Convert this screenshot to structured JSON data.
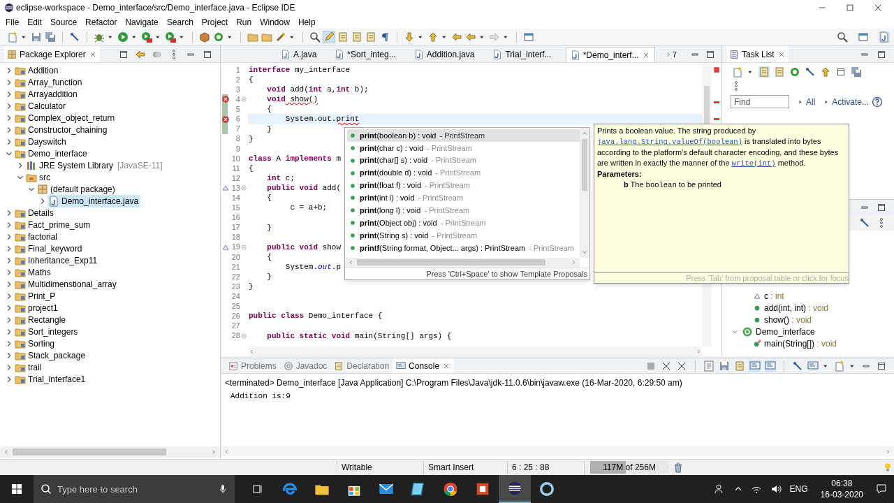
{
  "window": {
    "title": "eclipse-workspace - Demo_interface/src/Demo_interface.java - Eclipse IDE"
  },
  "menu": [
    "File",
    "Edit",
    "Source",
    "Refactor",
    "Navigate",
    "Search",
    "Project",
    "Run",
    "Window",
    "Help"
  ],
  "package_explorer": {
    "title": "Package Explorer",
    "items": [
      {
        "label": "Addition",
        "kind": "project",
        "expanded": false,
        "selected": false
      },
      {
        "label": "Array_function",
        "kind": "project",
        "expanded": false,
        "selected": false
      },
      {
        "label": "Arrayaddition",
        "kind": "project",
        "expanded": false,
        "selected": false
      },
      {
        "label": "Calculator",
        "kind": "project",
        "expanded": false,
        "selected": false
      },
      {
        "label": "Complex_object_return",
        "kind": "project",
        "expanded": false,
        "selected": false
      },
      {
        "label": "Constructor_chaining",
        "kind": "project",
        "expanded": false,
        "selected": false
      },
      {
        "label": "Dayswitch",
        "kind": "project",
        "expanded": false,
        "selected": false
      },
      {
        "label": "Demo_interface",
        "kind": "project",
        "expanded": true,
        "selected": false,
        "children": [
          {
            "label": "JRE System Library",
            "decoration": "[JavaSE-11]",
            "kind": "library",
            "expanded": false,
            "selected": false
          },
          {
            "label": "src",
            "kind": "folder",
            "expanded": true,
            "selected": false,
            "children": [
              {
                "label": "(default package)",
                "kind": "package",
                "expanded": true,
                "selected": false,
                "children": [
                  {
                    "label": "Demo_interface.java",
                    "kind": "file",
                    "expanded": false,
                    "selected": true
                  }
                ]
              }
            ]
          }
        ]
      },
      {
        "label": "Details",
        "kind": "project",
        "expanded": false,
        "selected": false
      },
      {
        "label": "Fact_prime_sum",
        "kind": "project",
        "expanded": false,
        "selected": false
      },
      {
        "label": "factorial",
        "kind": "project",
        "expanded": false,
        "selected": false
      },
      {
        "label": "Final_keyword",
        "kind": "project",
        "expanded": false,
        "selected": false
      },
      {
        "label": "Inheritance_Exp11",
        "kind": "project",
        "expanded": false,
        "selected": false
      },
      {
        "label": "Maths",
        "kind": "project",
        "expanded": false,
        "selected": false
      },
      {
        "label": "Multidimenstional_array",
        "kind": "project",
        "expanded": false,
        "selected": false
      },
      {
        "label": "Print_P",
        "kind": "project",
        "expanded": false,
        "selected": false
      },
      {
        "label": "project1",
        "kind": "project",
        "expanded": false,
        "selected": false
      },
      {
        "label": "Rectangle",
        "kind": "project",
        "expanded": false,
        "selected": false
      },
      {
        "label": "Sort_integers",
        "kind": "project",
        "expanded": false,
        "selected": false
      },
      {
        "label": "Sorting",
        "kind": "project",
        "expanded": false,
        "selected": false
      },
      {
        "label": "Stack_package",
        "kind": "project",
        "expanded": false,
        "selected": false
      },
      {
        "label": "trail",
        "kind": "project",
        "expanded": false,
        "selected": false
      },
      {
        "label": "Trial_interface1",
        "kind": "project",
        "expanded": false,
        "selected": false
      }
    ]
  },
  "editor": {
    "tabs": [
      {
        "label": "A.java",
        "selected": false
      },
      {
        "label": "*Sort_integ...",
        "selected": false
      },
      {
        "label": "Addition.java",
        "selected": false
      },
      {
        "label": "Trial_interf...",
        "selected": false
      },
      {
        "label": "*Demo_interf...",
        "selected": true
      }
    ],
    "overflow": "7",
    "lines": [
      {
        "number": "1",
        "current": false,
        "changed": false,
        "folding": false,
        "segments": [
          {
            "t": "interface",
            "kind": "keyword"
          },
          {
            "t": " my_interface"
          }
        ]
      },
      {
        "number": "2",
        "current": false,
        "changed": false,
        "folding": false,
        "segments": [
          {
            "t": "{"
          }
        ]
      },
      {
        "number": "3",
        "current": false,
        "changed": false,
        "folding": false,
        "segments": [
          {
            "t": "    void",
            "kind": "keyword"
          },
          {
            "t": " add("
          },
          {
            "t": "int",
            "kind": "keyword"
          },
          {
            "t": " a,"
          },
          {
            "t": "int",
            "kind": "keyword"
          },
          {
            "t": " b);"
          }
        ]
      },
      {
        "number": "4",
        "current": false,
        "changed": true,
        "folding": true,
        "marker": {
          "kind": "error"
        },
        "segments": [
          {
            "t": "    void",
            "kind": "keyword"
          },
          {
            "t": " show()",
            "kind": "error"
          }
        ]
      },
      {
        "number": "5",
        "current": false,
        "changed": true,
        "folding": false,
        "segments": [
          {
            "t": "    {"
          }
        ]
      },
      {
        "number": "6",
        "current": true,
        "changed": true,
        "folding": false,
        "marker": {
          "kind": "error"
        },
        "segments": [
          {
            "t": "        System.out."
          },
          {
            "t": "print",
            "kind": "error"
          }
        ]
      },
      {
        "number": "7",
        "current": false,
        "changed": true,
        "folding": false,
        "segments": [
          {
            "t": "    }"
          }
        ]
      },
      {
        "number": "8",
        "current": false,
        "changed": false,
        "folding": false,
        "segments": [
          {
            "t": "}"
          }
        ]
      },
      {
        "number": "9",
        "current": false,
        "changed": false,
        "folding": false
      },
      {
        "number": "10",
        "current": false,
        "changed": false,
        "folding": false,
        "segments": [
          {
            "t": "class",
            "kind": "keyword"
          },
          {
            "t": " A "
          },
          {
            "t": "implements",
            "kind": "keyword"
          },
          {
            "t": " m"
          }
        ]
      },
      {
        "number": "11",
        "current": false,
        "changed": false,
        "folding": false,
        "segments": [
          {
            "t": "{"
          }
        ]
      },
      {
        "number": "12",
        "current": false,
        "changed": false,
        "folding": false,
        "segments": [
          {
            "t": "    int",
            "kind": "keyword"
          },
          {
            "t": " c;"
          }
        ]
      },
      {
        "number": "13",
        "current": false,
        "changed": false,
        "folding": true,
        "marker": {
          "kind": "override"
        },
        "segments": [
          {
            "t": "    public void",
            "kind": "keyword"
          },
          {
            "t": " add("
          }
        ]
      },
      {
        "number": "14",
        "current": false,
        "changed": false,
        "folding": false,
        "segments": [
          {
            "t": "    {"
          }
        ]
      },
      {
        "number": "15",
        "current": false,
        "changed": false,
        "folding": false,
        "segments": [
          {
            "t": "         c = a+b;"
          }
        ]
      },
      {
        "number": "16",
        "current": false,
        "changed": false,
        "folding": false
      },
      {
        "number": "17",
        "current": false,
        "changed": false,
        "folding": false,
        "segments": [
          {
            "t": "    }"
          }
        ]
      },
      {
        "number": "18",
        "current": false,
        "changed": false,
        "folding": false
      },
      {
        "number": "19",
        "current": false,
        "changed": false,
        "folding": true,
        "marker": {
          "kind": "override"
        },
        "segments": [
          {
            "t": "    public void",
            "kind": "keyword"
          },
          {
            "t": " show"
          }
        ]
      },
      {
        "number": "20",
        "current": false,
        "changed": false,
        "folding": false,
        "segments": [
          {
            "t": "    {"
          }
        ]
      },
      {
        "number": "21",
        "current": false,
        "changed": false,
        "folding": false,
        "segments": [
          {
            "t": "        System."
          },
          {
            "t": "out",
            "kind": "field"
          },
          {
            "t": ".p"
          }
        ]
      },
      {
        "number": "22",
        "current": false,
        "changed": false,
        "folding": false,
        "segments": [
          {
            "t": "    }"
          }
        ]
      },
      {
        "number": "23",
        "current": false,
        "changed": false,
        "folding": false,
        "segments": [
          {
            "t": "}"
          }
        ]
      },
      {
        "number": "24",
        "current": false,
        "changed": false,
        "folding": false
      },
      {
        "number": "25",
        "current": false,
        "changed": false,
        "folding": false
      },
      {
        "number": "26",
        "current": false,
        "changed": false,
        "folding": false,
        "segments": [
          {
            "t": "public class",
            "kind": "keyword"
          },
          {
            "t": " Demo_interface {"
          }
        ]
      },
      {
        "number": "27",
        "current": false,
        "changed": false,
        "folding": false
      },
      {
        "number": "28",
        "current": false,
        "changed": false,
        "folding": true,
        "segments": [
          {
            "t": "    public static void",
            "kind": "keyword"
          },
          {
            "t": " main(String[] args) {"
          }
        ]
      }
    ]
  },
  "autocomplete": {
    "items": [
      {
        "label": "**print**(boolean b) : void",
        "owner": "- PrintStream",
        "selected": true
      },
      {
        "label": "**print**(char c) : void",
        "owner": "- PrintStream",
        "selected": false
      },
      {
        "label": "**print**(char[] s) : void",
        "owner": "- PrintStream",
        "selected": false
      },
      {
        "label": "**print**(double d) : void",
        "owner": "- PrintStream",
        "selected": false
      },
      {
        "label": "**print**(float f) : void",
        "owner": "- PrintStream",
        "selected": false
      },
      {
        "label": "**print**(int i) : void",
        "owner": "- PrintStream",
        "selected": false
      },
      {
        "label": "**print**(long l) : void",
        "owner": "- PrintStream",
        "selected": false
      },
      {
        "label": "**print**(Object obj) : void",
        "owner": "- PrintStream",
        "selected": false
      },
      {
        "label": "**print**(String s) : void",
        "owner": "- PrintStream",
        "selected": false
      },
      {
        "label": "**printf**(String format, Object... args) : PrintStream",
        "owner": "- PrintStream",
        "selected": false
      }
    ],
    "footer": "Press 'Ctrl+Space' to show Template Proposals"
  },
  "javadoc": {
    "description": [
      {
        "text": "Prints a boolean value. The string produced by "
      },
      {
        "text": "java.lang.String.valueOf(boolean)",
        "kind": "link"
      },
      {
        "text": " is translated into bytes according to the platform's default character encoding, and these bytes are written in exactly the manner of the "
      },
      {
        "text": "write(int)",
        "kind": "link"
      },
      {
        "text": " method."
      }
    ],
    "params_heading": "Parameters:",
    "params": [
      [
        {
          "text": "b",
          "kind": "name"
        },
        {
          "text": " The "
        },
        {
          "text": "boolean",
          "kind": "code"
        },
        {
          "text": " to be printed"
        }
      ]
    ],
    "footer": "Press 'Tab' from proposal table or click for focus"
  },
  "task_list": {
    "title": "Task List",
    "find_placeholder": "Find",
    "links": [
      "All",
      "Activate..."
    ]
  },
  "outline": {
    "items": [
      {
        "label": "c",
        "type": ": int",
        "kind": "field"
      },
      {
        "label": "add(int, int)",
        "type": ": void",
        "kind": "method"
      },
      {
        "label": "show()",
        "type": ": void",
        "kind": "method"
      },
      {
        "label": "Demo_interface",
        "kind": "class",
        "expanded": true,
        "children": [
          {
            "label": "main(String[])",
            "type": ": void",
            "kind": "static-method"
          }
        ]
      }
    ]
  },
  "bottom_panel": {
    "tabs": [
      {
        "label": "Problems",
        "kind": "problems",
        "selected": false
      },
      {
        "label": "Javadoc",
        "kind": "javadoc",
        "selected": false
      },
      {
        "label": "Declaration",
        "kind": "declaration",
        "selected": false
      },
      {
        "label": "Console",
        "kind": "console",
        "selected": true
      }
    ],
    "console": {
      "header": "<terminated> Demo_interface [Java Application] C:\\Program Files\\Java\\jdk-11.0.6\\bin\\javaw.exe (16-Mar-2020, 6:29:50 am)",
      "output": [
        "Addition is:9"
      ]
    }
  },
  "status_bar": {
    "mode": "Writable",
    "insert": "Smart Insert",
    "position": "6 : 25 : 88",
    "heap": {
      "text": "117M of 256M",
      "level": 0.457
    }
  },
  "taskbar": {
    "search_placeholder": "Type here to search",
    "apps": [
      {
        "kind": "edge",
        "active": false
      },
      {
        "kind": "explorer",
        "active": false
      },
      {
        "kind": "store",
        "active": false
      },
      {
        "kind": "mail",
        "active": false
      },
      {
        "kind": "notes",
        "active": false
      },
      {
        "kind": "chrome",
        "active": false
      },
      {
        "kind": "powerpoint",
        "active": false
      },
      {
        "kind": "eclipse",
        "active": true
      },
      {
        "kind": "ring",
        "active": false
      }
    ],
    "language": "ENG",
    "time": "06:38",
    "date": "16-03-2020"
  }
}
